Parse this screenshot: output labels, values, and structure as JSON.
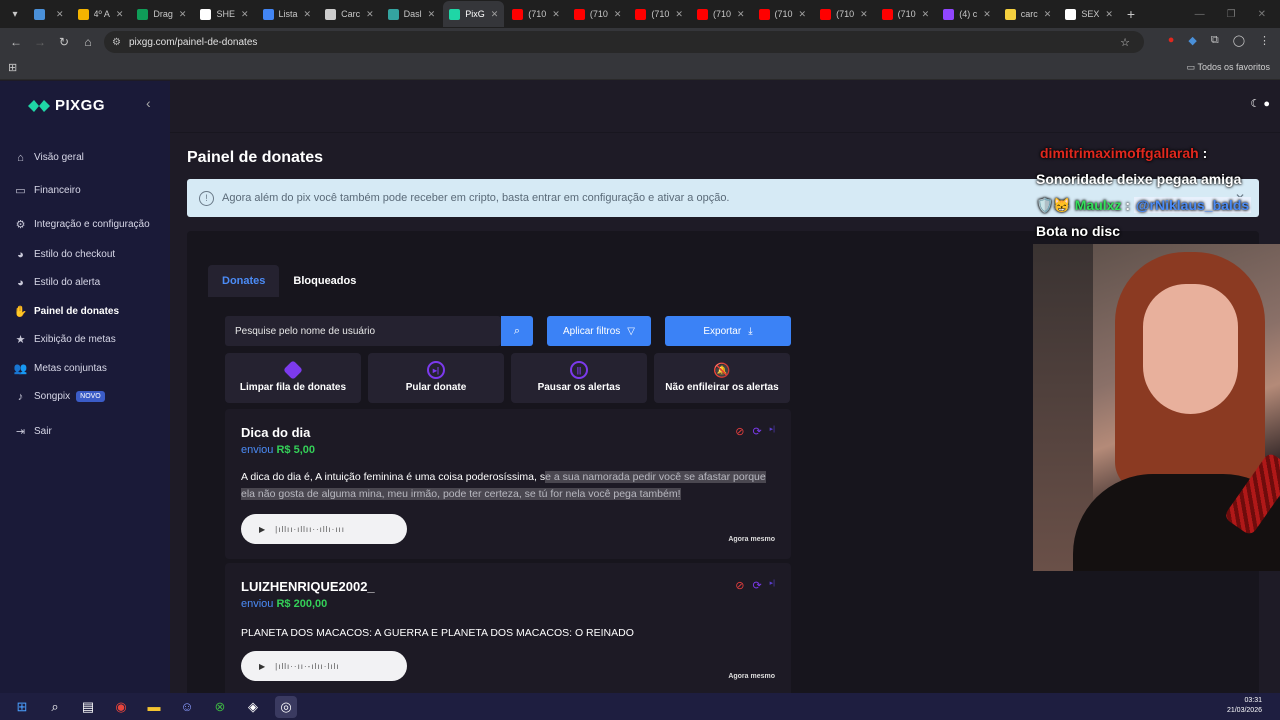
{
  "browser": {
    "tabs": [
      {
        "title": "",
        "color": "#4a90d9"
      },
      {
        "title": "4º A",
        "color": "#f4b400"
      },
      {
        "title": "Drag",
        "color": "#0f9d58"
      },
      {
        "title": "SHE",
        "color": "#ffffff"
      },
      {
        "title": "Lista",
        "color": "#4285f4"
      },
      {
        "title": "Carc",
        "color": "#cccccc"
      },
      {
        "title": "Dasl",
        "color": "#34a4a0"
      },
      {
        "title": "PixG",
        "color": "#1fd6a6",
        "active": true
      },
      {
        "title": "(710",
        "color": "#ff0000"
      },
      {
        "title": "(710",
        "color": "#ff0000"
      },
      {
        "title": "(710",
        "color": "#ff0000"
      },
      {
        "title": "(710",
        "color": "#ff0000"
      },
      {
        "title": "(710",
        "color": "#ff0000"
      },
      {
        "title": "(710",
        "color": "#ff0000"
      },
      {
        "title": "(710",
        "color": "#ff0000"
      },
      {
        "title": "(4) c",
        "color": "#9146ff"
      },
      {
        "title": "carc",
        "color": "#f4d03f"
      },
      {
        "title": "SEX",
        "color": "#ffffff"
      }
    ],
    "url": "pixgg.com/painel-de-donates",
    "bookmarks_label": "Todos os favoritos"
  },
  "sidebar": {
    "brand": "PIXGG",
    "items": [
      {
        "label": "Visão geral",
        "icon": "home-icon"
      },
      {
        "label": "Financeiro",
        "icon": "wallet-icon"
      },
      {
        "label": "Integração e configuração",
        "icon": "gear-icon"
      },
      {
        "label": "Estilo do checkout",
        "icon": "palette-icon"
      },
      {
        "label": "Estilo do alerta",
        "icon": "palette-icon"
      },
      {
        "label": "Painel de donates",
        "icon": "hand-coins-icon"
      },
      {
        "label": "Exibição de metas",
        "icon": "star-icon"
      },
      {
        "label": "Metas conjuntas",
        "icon": "users-icon"
      },
      {
        "label": "Songpix",
        "icon": "music-icon",
        "badge": "NOVO"
      },
      {
        "label": "Sair",
        "icon": "logout-icon"
      }
    ]
  },
  "main": {
    "title": "Painel de donates",
    "alert": "Agora além do pix você também pode receber em cripto, basta entrar em configuração e ativar a opção.",
    "tabs": [
      "Donates",
      "Bloqueados"
    ],
    "search_placeholder": "Pesquise pelo nome de usuário",
    "filter_label": "Aplicar filtros",
    "export_label": "Exportar",
    "actions": [
      "Limpar fila de donates",
      "Pular donate",
      "Pausar os alertas",
      "Não enfileirar os alertas"
    ],
    "donations": [
      {
        "name": "Dica do dia",
        "sent_label": "enviou",
        "amount": "R$ 5,00",
        "message_plain": "A dica do dia é, A intuição feminina é uma coisa poderosíssima, s",
        "message_highlight": "e a sua namorada pedir você se afastar porque ela não gosta de alguma mina, meu irmão, pode ter certeza, se tú for nela você pega também!",
        "time": "Agora mesmo"
      },
      {
        "name": "LUIZHENRIQUE2002_",
        "sent_label": "enviou",
        "amount": "R$ 200,00",
        "message_plain": "PLANETA DOS MACACOS: A GUERRA E PLANETA DOS MACACOS: O REINADO",
        "message_highlight": "",
        "time": "Agora mesmo"
      }
    ]
  },
  "overlay": {
    "chat_user1": "dimitrimaximoffgallarah",
    "chat_sep": ":",
    "chat_msg1": "Sonoridade deixe pegaa amiga",
    "chat_emotes": "🛡️😸",
    "chat_user2": "Maulxz",
    "chat_sep2": ":",
    "chat_mention": "@rNiklaus_balds",
    "chat_msg2": "Bota no disc"
  },
  "taskbar": {
    "time": "03:31",
    "date": "21/03/2026"
  },
  "colors": {
    "accent": "#3b82f6",
    "amount_green": "#34d058",
    "sidebar_bg": "#1a1a38"
  }
}
